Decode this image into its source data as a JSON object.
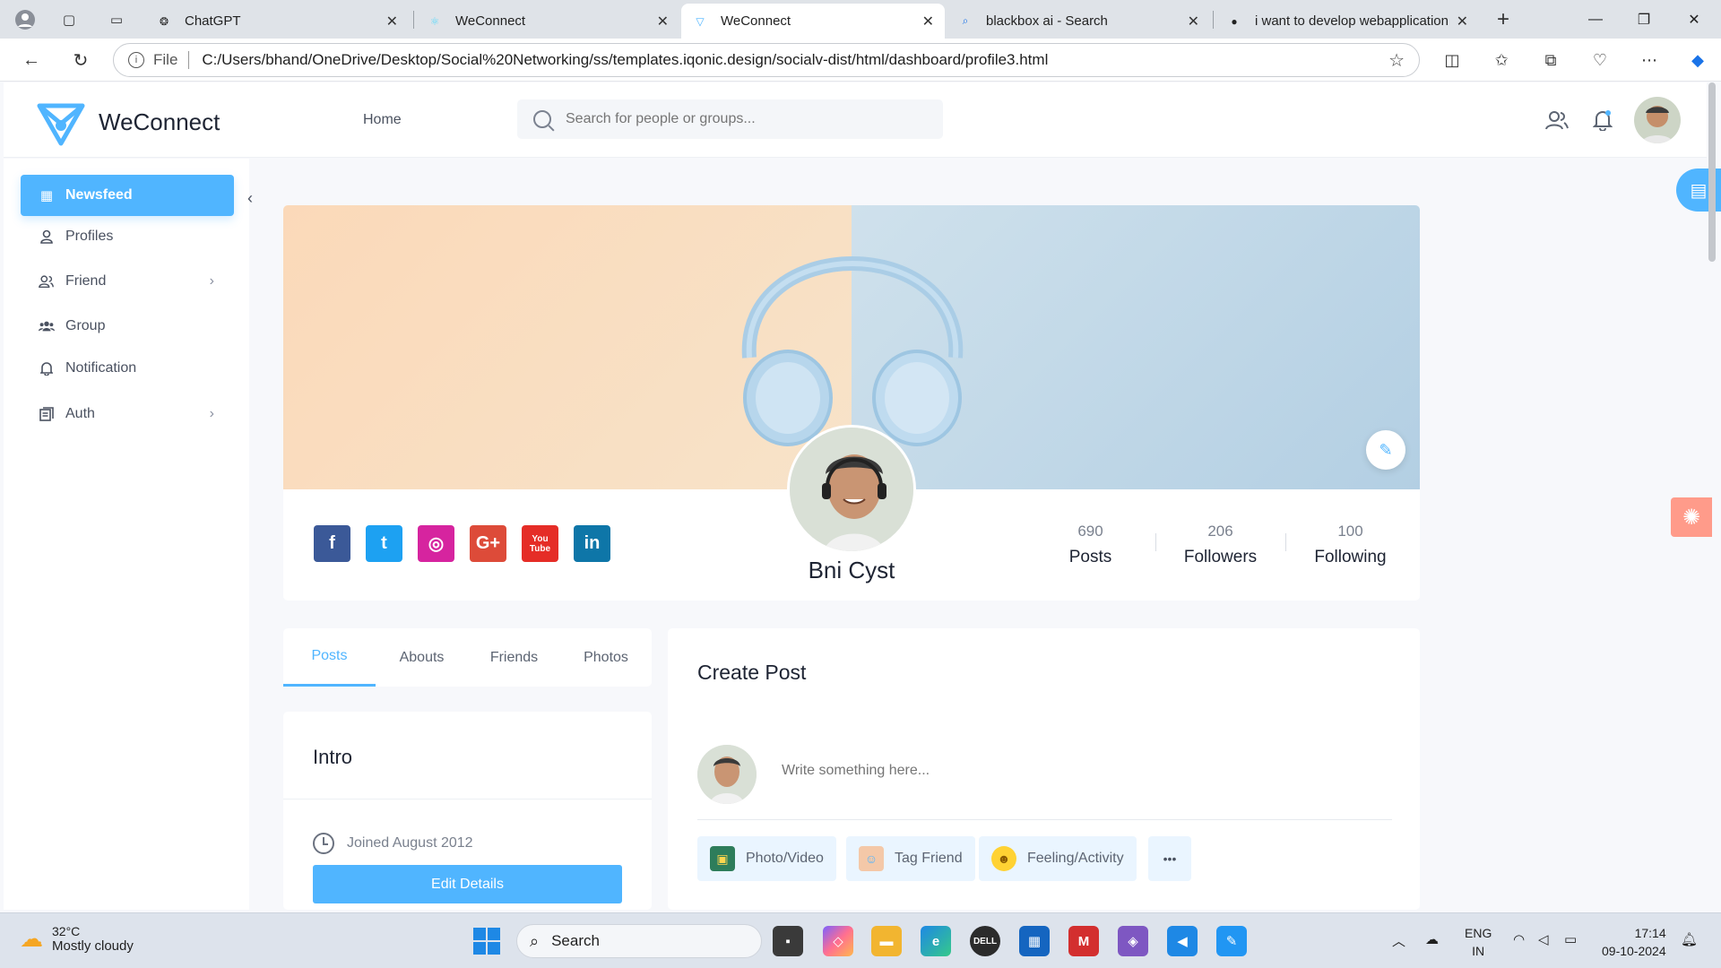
{
  "browser": {
    "tabs": [
      {
        "title": "ChatGPT",
        "icon": "chatgpt-icon"
      },
      {
        "title": "WeConnect",
        "icon": "react-icon"
      },
      {
        "title": "WeConnect",
        "icon": "weconnect-icon"
      },
      {
        "title": "blackbox ai - Search",
        "icon": "search-icon"
      },
      {
        "title": "i want to develop webapplication",
        "icon": "openai-icon"
      }
    ],
    "scheme": "File",
    "url": "C:/Users/bhand/OneDrive/Desktop/Social%20Networking/ss/templates.iqonic.design/socialv-dist/html/dashboard/profile3.html"
  },
  "app": {
    "name": "WeConnect",
    "nav_home": "Home",
    "search_placeholder": "Search for people or groups...",
    "brand_color": "#50b5ff"
  },
  "sidebar": {
    "items": [
      {
        "label": "Newsfeed",
        "icon": "newsfeed-icon",
        "active": true
      },
      {
        "label": "Profiles",
        "icon": "user-icon"
      },
      {
        "label": "Friend",
        "icon": "friends-icon",
        "has_submenu": true
      },
      {
        "label": "Group",
        "icon": "group-icon"
      },
      {
        "label": "Notification",
        "icon": "bell-icon"
      },
      {
        "label": "Auth",
        "icon": "auth-icon",
        "has_submenu": true
      }
    ]
  },
  "profile": {
    "name": "Bni Cyst",
    "stats": [
      {
        "value": "690",
        "label": "Posts"
      },
      {
        "value": "206",
        "label": "Followers"
      },
      {
        "value": "100",
        "label": "Following"
      }
    ],
    "socials": [
      {
        "name": "facebook-icon",
        "glyph": "f",
        "color": "#3b5998"
      },
      {
        "name": "twitter-icon",
        "glyph": "t",
        "color": "#1da1f2"
      },
      {
        "name": "instagram-icon",
        "glyph": "◎",
        "color": "#d6249f"
      },
      {
        "name": "google-plus-icon",
        "glyph": "G+",
        "color": "#dd4b39"
      },
      {
        "name": "youtube-icon",
        "glyph": "You Tube",
        "color": "#e52d27"
      },
      {
        "name": "linkedin-icon",
        "glyph": "in",
        "color": "#0e76a8"
      }
    ]
  },
  "tabs": [
    "Posts",
    "Abouts",
    "Friends",
    "Photos"
  ],
  "intro": {
    "title": "Intro",
    "joined": "Joined August 2012",
    "edit_button": "Edit Details"
  },
  "create_post": {
    "title": "Create Post",
    "placeholder": "Write something here...",
    "actions": [
      "Photo/Video",
      "Tag Friend",
      "Feeling/Activity"
    ],
    "more": "•••"
  },
  "taskbar": {
    "temp": "32°C",
    "weather": "Mostly cloudy",
    "search": "Search",
    "lang_top": "ENG",
    "lang_bottom": "IN",
    "time": "17:14",
    "date": "09-10-2024"
  }
}
